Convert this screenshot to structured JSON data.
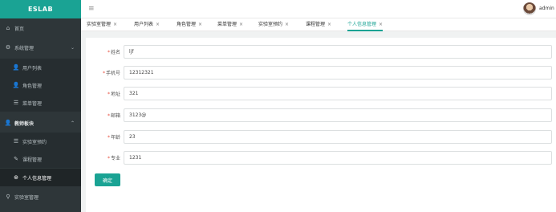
{
  "app": {
    "title": "ESLAB"
  },
  "sidebar": {
    "items": [
      {
        "label": "首页",
        "icon": "home-icon"
      },
      {
        "label": "系统管理",
        "icon": "gear-icon",
        "expanded": false
      },
      {
        "label": "用户列表",
        "icon": "user-icon"
      },
      {
        "label": "角色管理",
        "icon": "user-icon"
      },
      {
        "label": "菜单管理",
        "icon": "list-icon"
      },
      {
        "label": "教师板块",
        "icon": "teacher-icon",
        "expanded": true
      },
      {
        "label": "实验室预约",
        "icon": "list-icon"
      },
      {
        "label": "课程管理",
        "icon": "edit-icon"
      },
      {
        "label": "个人信息管理",
        "icon": "settings-icon"
      },
      {
        "label": "实验室管理",
        "icon": "location-icon"
      }
    ]
  },
  "header": {
    "username": "admin"
  },
  "tabs": [
    {
      "label": "实验室管理"
    },
    {
      "label": "用户列表"
    },
    {
      "label": "角色管理"
    },
    {
      "label": "菜单管理"
    },
    {
      "label": "实验室预约"
    },
    {
      "label": "课程管理"
    },
    {
      "label": "个人信息管理",
      "active": true
    }
  ],
  "form": {
    "fields": [
      {
        "label": "姓名",
        "value": "ljf"
      },
      {
        "label": "手机号",
        "value": "12312321"
      },
      {
        "label": "地址",
        "value": "321"
      },
      {
        "label": "邮箱",
        "value": "3123@"
      },
      {
        "label": "年龄",
        "value": "23"
      },
      {
        "label": "专业",
        "value": "1231"
      }
    ],
    "required_mark": "*",
    "submit_label": "确定"
  },
  "colors": {
    "accent": "#1aa394",
    "sidebar_bg": "#2e3639",
    "required": "#e74c3c"
  }
}
